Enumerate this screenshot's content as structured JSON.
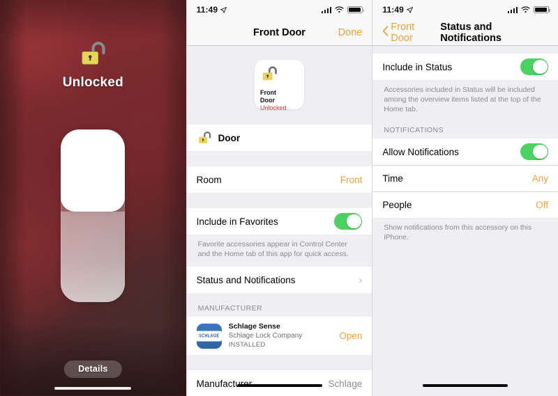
{
  "lock_screen": {
    "state_label": "Unlocked",
    "padlock_icon": "open-padlock-icon",
    "slider_name": "lock-slider",
    "details_button": "Details",
    "home_indicator": "home-indicator"
  },
  "accessory": {
    "status_bar": {
      "time": "11:49",
      "location_icon": "location-arrow-icon",
      "cellular_icon": "cellular-bars-icon",
      "wifi_icon": "wifi-icon",
      "battery_icon": "battery-icon"
    },
    "nav": {
      "title": "Front Door",
      "done_label": "Done"
    },
    "tile": {
      "icon": "open-padlock-icon",
      "name_line1": "Front",
      "name_line2": "Door",
      "state": "Unlocked",
      "state_color": "#e0382e"
    },
    "door_row": {
      "icon": "open-padlock-icon",
      "label": "Door"
    },
    "room_row": {
      "label": "Room",
      "value": "Front"
    },
    "favorites_row": {
      "label": "Include in Favorites",
      "toggle_state": "on"
    },
    "favorites_footnote": "Favorite accessories appear in Control Center and the Home tab of this app for quick access.",
    "status_notifications_row": {
      "label": "Status and Notifications",
      "chevron": "chevron-right-icon"
    },
    "manufacturer_header": "MANUFACTURER",
    "manufacturer_app": {
      "icon": "schlage-app-icon",
      "badge_text": "SCHLAGE",
      "name": "Schlage Sense",
      "company": "Schlage Lock Company",
      "installed": "INSTALLED",
      "action": "Open"
    },
    "manufacturer_row": {
      "label": "Manufacturer",
      "value": "Schlage"
    }
  },
  "status_notifications": {
    "status_bar": {
      "time": "11:49",
      "location_icon": "location-arrow-icon",
      "cellular_icon": "cellular-bars-icon",
      "wifi_icon": "wifi-icon",
      "battery_icon": "battery-icon"
    },
    "nav": {
      "back_label": "Front Door",
      "back_icon": "chevron-left-icon",
      "title": "Status and Notifications"
    },
    "include_in_status": {
      "label": "Include in Status",
      "toggle_state": "on"
    },
    "include_footnote": "Accessories included in Status will be included among the overview items listed at the top of the Home tab.",
    "notifications_header": "NOTIFICATIONS",
    "allow_notifications": {
      "label": "Allow Notifications",
      "toggle_state": "on"
    },
    "time_row": {
      "label": "Time",
      "value": "Any"
    },
    "people_row": {
      "label": "People",
      "value": "Off"
    },
    "notifications_footnote": "Show notifications from this accessory on this iPhone."
  },
  "colors": {
    "accent": "#e8a33d",
    "toggle_on": "#4cd263",
    "alert_red": "#e0382e",
    "panel_bg": "#eeeef3"
  }
}
